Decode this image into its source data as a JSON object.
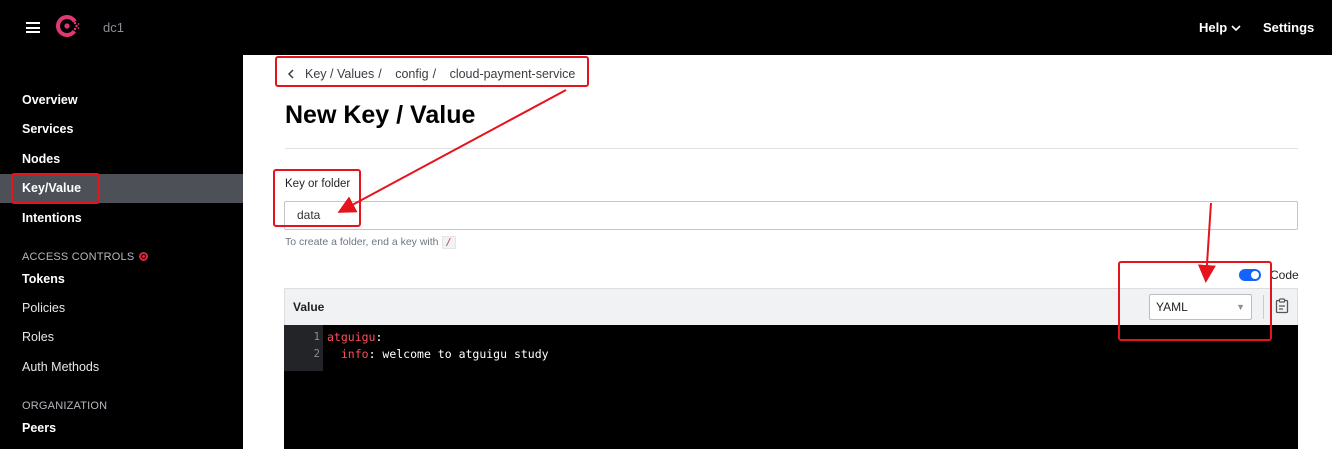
{
  "header": {
    "datacenter": "dc1",
    "help_label": "Help",
    "settings_label": "Settings"
  },
  "sidebar": {
    "items": [
      {
        "label": "Overview"
      },
      {
        "label": "Services"
      },
      {
        "label": "Nodes"
      },
      {
        "label": "Key/Value",
        "active": true
      },
      {
        "label": "Intentions"
      }
    ],
    "access_controls": {
      "heading": "ACCESS CONTROLS",
      "items": [
        {
          "label": "Tokens"
        },
        {
          "label": "Policies"
        },
        {
          "label": "Roles"
        },
        {
          "label": "Auth Methods"
        }
      ]
    },
    "organization": {
      "heading": "ORGANIZATION",
      "items": [
        {
          "label": "Peers"
        }
      ]
    }
  },
  "breadcrumb": [
    "Key / Values",
    "config",
    "cloud-payment-service"
  ],
  "page_title": "New Key / Value",
  "form": {
    "key_label": "Key or folder",
    "key_value": "data",
    "hint_text": "To create a folder, end a key with",
    "hint_code": "/",
    "code_toggle_label": "Code",
    "code_toggle_on": true,
    "value_label": "Value",
    "syntax_selected": "YAML"
  },
  "editor": {
    "lines": [
      {
        "num": "1",
        "key": "atguigu",
        "rest": ":"
      },
      {
        "num": "2",
        "indent": "  ",
        "key": "info",
        "rest": ": welcome to atguigu study"
      }
    ]
  },
  "colors": {
    "accent_blue": "#1563ff",
    "consul_pink": "#e03875",
    "annotation_red": "#e5141c",
    "yaml_key": "#ff4d5e"
  }
}
